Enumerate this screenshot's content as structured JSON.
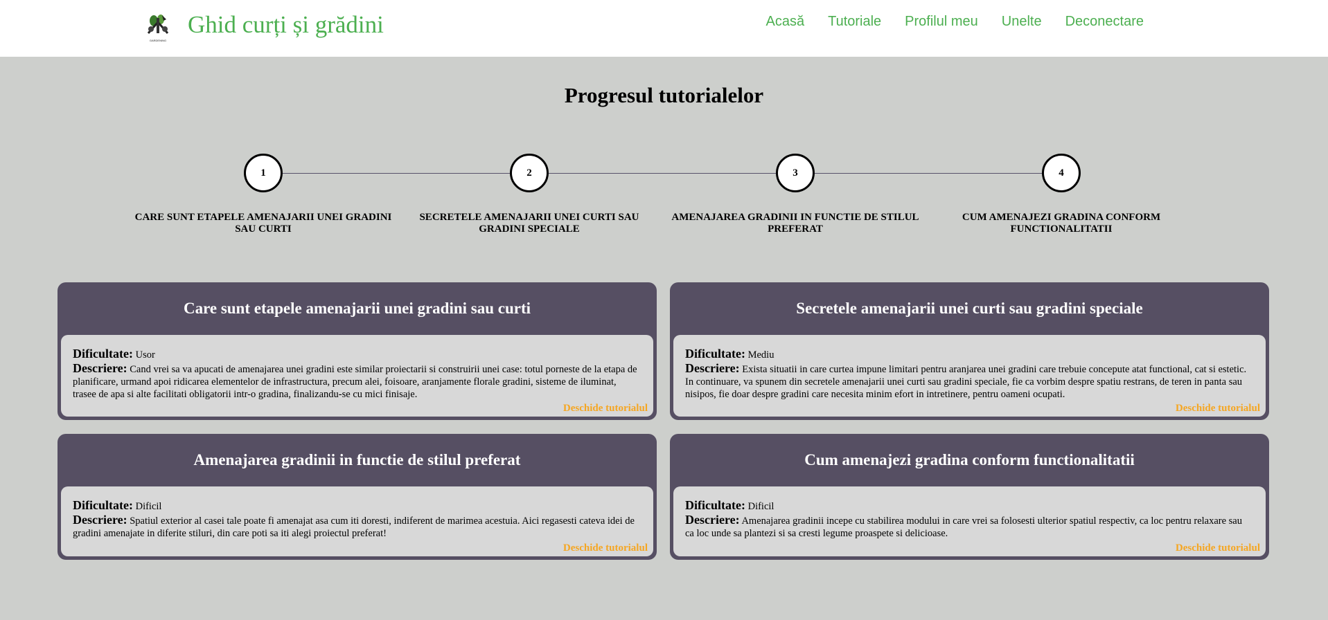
{
  "header": {
    "logo_caption": "GARDENING",
    "title": "Ghid curți și grădini",
    "nav": [
      "Acasă",
      "Tutoriale",
      "Profilul meu",
      "Unelte",
      "Deconectare"
    ]
  },
  "progress": {
    "title": "Progresul tutorialelor",
    "steps": [
      {
        "number": "1",
        "label": "CARE SUNT ETAPELE AMENAJARII UNEI GRADINI SAU CURTI"
      },
      {
        "number": "2",
        "label": "SECRETELE AMENAJARII UNEI CURTI SAU GRADINI SPECIALE"
      },
      {
        "number": "3",
        "label": "AMENAJAREA GRADINII IN FUNCTIE DE STILUL PREFERAT"
      },
      {
        "number": "4",
        "label": "CUM AMENAJEZI GRADINA CONFORM FUNCTIONALITATII"
      }
    ]
  },
  "labels": {
    "difficulty": "Dificultate:",
    "description": "Descriere:",
    "open_link": "Deschide tutorialul"
  },
  "tutorials": [
    {
      "title": "Care sunt etapele amenajarii unei gradini sau curti",
      "difficulty": "Usor",
      "description": "Cand vrei sa va apucati de amenajarea unei gradini este similar proiectarii si construirii unei case: totul porneste de la etapa de planificare, urmand apoi ridicarea elementelor de infrastructura, precum alei, foisoare, aranjamente florale gradini, sisteme de iluminat, trasee de apa si alte facilitati obligatorii intr-o gradina, finalizandu-se cu mici finisaje."
    },
    {
      "title": "Secretele amenajarii unei curti sau gradini speciale",
      "difficulty": "Mediu",
      "description": "Exista situatii in care curtea impune limitari pentru aranjarea unei gradini care trebuie concepute atat functional, cat si estetic. In continuare, va spunem din secretele amenajarii unei curti sau gradini speciale, fie ca vorbim despre spatiu restrans, de teren in panta sau nisipos, fie doar despre gradini care necesita minim efort in intretinere, pentru oameni ocupati."
    },
    {
      "title": "Amenajarea gradinii in functie de stilul preferat",
      "difficulty": "Dificil",
      "description": "Spatiul exterior al casei tale poate fi amenajat asa cum iti doresti, indiferent de marimea acestuia. Aici regasesti cateva idei de gradini amenajate in diferite stiluri, din care poti sa iti alegi proiectul preferat!"
    },
    {
      "title": "Cum amenajezi gradina conform functionalitatii",
      "difficulty": "Dificil",
      "description": "Amenajarea gradinii incepe cu stabilirea modului in care vrei sa folosesti ulterior spatiul respectiv, ca loc pentru relaxare sau ca loc unde sa plantezi si sa cresti legume proaspete si delicioase."
    }
  ],
  "colors": {
    "accent_green": "#4caf50",
    "card_header": "#564f63",
    "link_orange": "#f5a623",
    "background": "#cdcfcc"
  }
}
